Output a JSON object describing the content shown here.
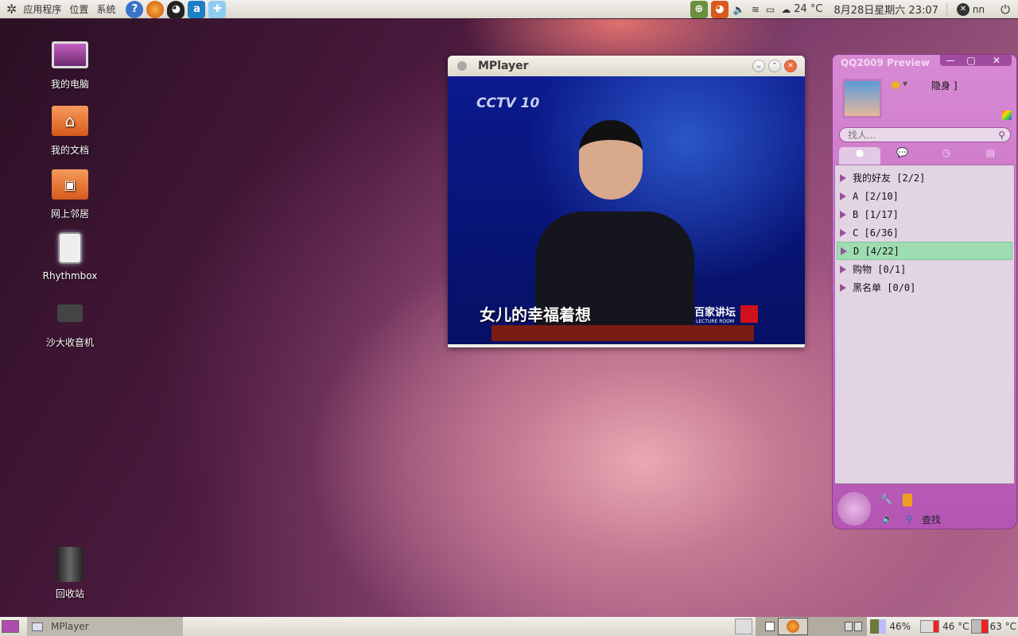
{
  "top_panel": {
    "menus": [
      "应用程序",
      "位置",
      "系统"
    ],
    "launchers": [
      "help-icon",
      "firefox-icon",
      "qq-icon",
      "text-editor-icon",
      "network-icon"
    ],
    "temperature": "24 °C",
    "clock": "8月28日星期六 23:07",
    "user": "nn"
  },
  "desktop_icons": [
    {
      "label": "我的电脑",
      "icon": "computer-icon"
    },
    {
      "label": "我的文档",
      "icon": "home-folder-icon"
    },
    {
      "label": "网上邻居",
      "icon": "network-folder-icon"
    },
    {
      "label": "Rhythmbox",
      "icon": "rhythmbox-icon"
    },
    {
      "label": "沙大收音机",
      "icon": "radio-icon"
    },
    {
      "label": "回收站",
      "icon": "trash-icon"
    }
  ],
  "mplayer": {
    "title": "MPlayer",
    "video": {
      "channel_logo": "CCTV 10",
      "subtitle": "女儿的幸福着想",
      "program": "百家讲坛",
      "program_en": "LECTURE ROOM"
    }
  },
  "qq": {
    "title": "QQ2009 Preview",
    "status": "隐身 ]",
    "search_placeholder": "找人...",
    "groups": [
      {
        "name": "我的好友",
        "count": "[2/2]"
      },
      {
        "name": "A",
        "count": "[2/10]"
      },
      {
        "name": "B",
        "count": "[1/17]"
      },
      {
        "name": "C",
        "count": "[6/36]"
      },
      {
        "name": "D",
        "count": "[4/22]",
        "selected": true
      },
      {
        "name": "购物",
        "count": "[0/1]"
      },
      {
        "name": "黑名单",
        "count": "[0/0]"
      }
    ],
    "find_label": "查找"
  },
  "bottom_panel": {
    "task": "MPlayer",
    "battery": "46%",
    "hdd_temp": "46 °C",
    "cpu_temp": "63 °C"
  }
}
